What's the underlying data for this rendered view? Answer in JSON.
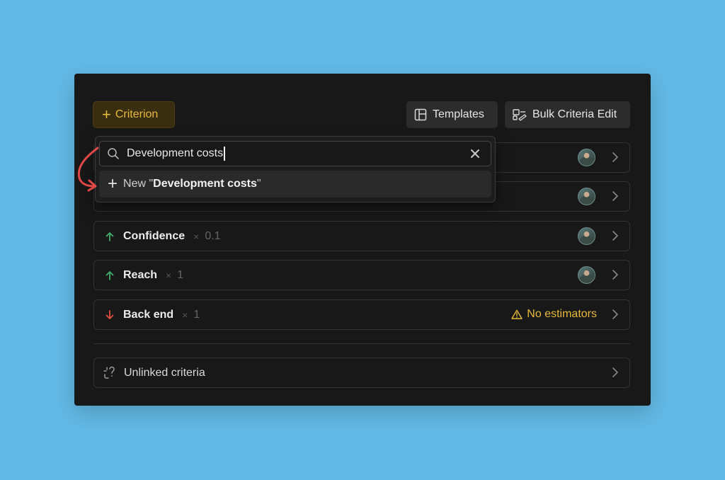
{
  "toolbar": {
    "add_criterion_label": "Criterion",
    "templates_label": "Templates",
    "bulk_edit_label": "Bulk Criteria Edit"
  },
  "search": {
    "value": "Development costs",
    "new_option_prefix": "New \"",
    "new_option_value": "Development costs",
    "new_option_suffix": "\""
  },
  "criteria": [
    {
      "name": "Confidence",
      "times": "×",
      "weight": "0.1",
      "direction": "up"
    },
    {
      "name": "Reach",
      "times": "×",
      "weight": "1",
      "direction": "up"
    },
    {
      "name": "Back end",
      "times": "×",
      "weight": "1",
      "direction": "down",
      "status": "No estimators"
    }
  ],
  "unlinked": {
    "label": "Unlinked criteria"
  },
  "colors": {
    "background": "#62b9e5",
    "panel": "#181818",
    "accent": "#e6b93c",
    "up_arrow": "#3fae6a",
    "down_arrow": "#e0513f",
    "annotation": "#e04848"
  }
}
